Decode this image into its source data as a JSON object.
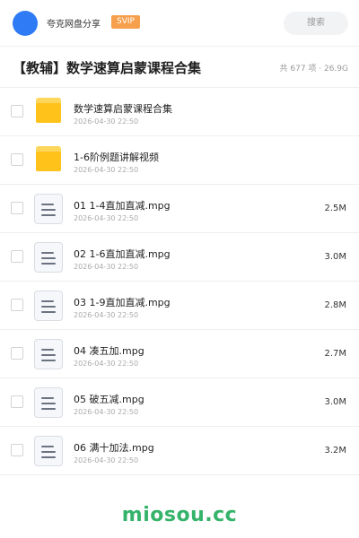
{
  "header": {
    "username": "夸克网盘分享",
    "badge": "SVIP",
    "search_label": "搜索"
  },
  "title_bar": {
    "title": "【教辅】数学速算启蒙课程合集",
    "summary": "共 677 项 · 26.9G"
  },
  "files": [
    {
      "type": "folder",
      "name": "数学速算启蒙课程合集",
      "date": "2026-04-30 22:50",
      "size": ""
    },
    {
      "type": "folder",
      "name": "1-6阶例题讲解视频",
      "date": "2026-04-30 22:50",
      "size": ""
    },
    {
      "type": "video",
      "name": "01 1-4直加直减.mpg",
      "date": "2026-04-30 22:50",
      "size": "2.5M"
    },
    {
      "type": "video",
      "name": "02 1-6直加直减.mpg",
      "date": "2026-04-30 22:50",
      "size": "3.0M"
    },
    {
      "type": "video",
      "name": "03 1-9直加直减.mpg",
      "date": "2026-04-30 22:50",
      "size": "2.8M"
    },
    {
      "type": "video",
      "name": "04 凑五加.mpg",
      "date": "2026-04-30 22:50",
      "size": "2.7M"
    },
    {
      "type": "video",
      "name": "05 破五减.mpg",
      "date": "2026-04-30 22:50",
      "size": "3.0M"
    },
    {
      "type": "video",
      "name": "06 满十加法.mpg",
      "date": "2026-04-30 22:50",
      "size": "3.2M"
    }
  ],
  "watermark": "miosou.cc",
  "colors": {
    "avatar": "#2f7bf5",
    "badge": "#f6a04d",
    "folder": "#ffc21a",
    "watermark": "#35b36a"
  }
}
